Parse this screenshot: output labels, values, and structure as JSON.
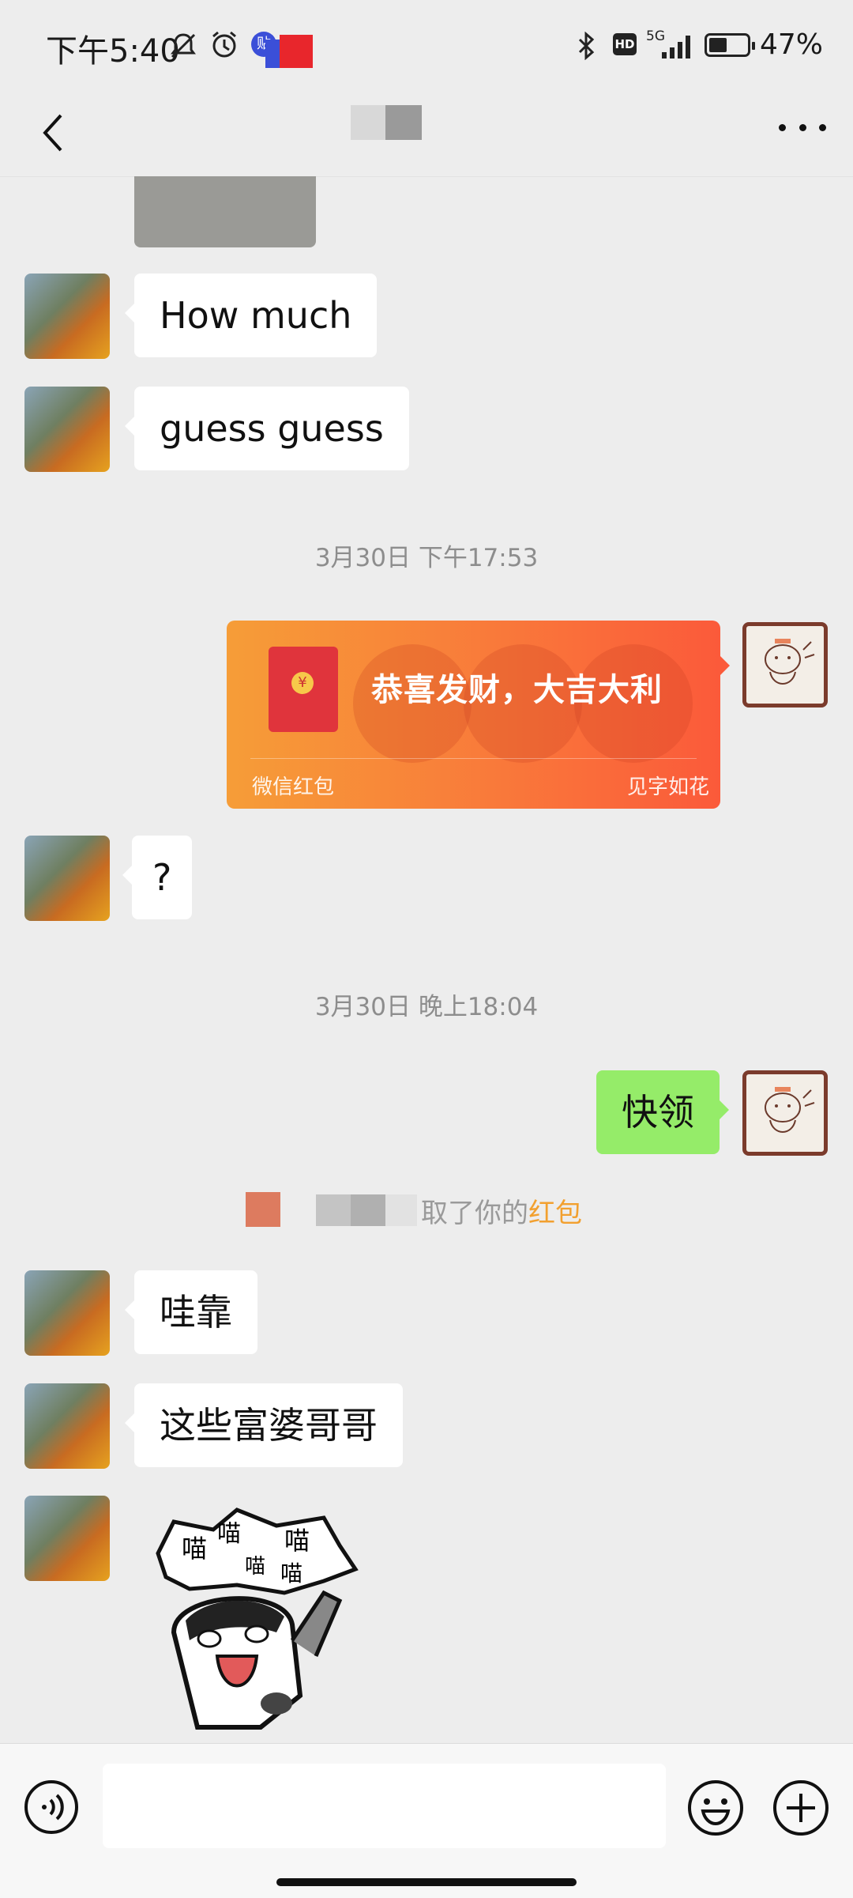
{
  "status_bar": {
    "time": "下午5:40",
    "network": "5G",
    "battery": "47%",
    "hd_badge": "HD",
    "sticker_badge": "贴"
  },
  "chat": {
    "back_icon": "chevron-left-icon",
    "more_icon": "ellipsis-icon"
  },
  "messages": [
    {
      "side": "left",
      "type": "text",
      "text": "How much"
    },
    {
      "side": "left",
      "type": "text",
      "text": "guess guess"
    },
    {
      "type": "timestamp",
      "text": "3月30日 下午17:53"
    },
    {
      "side": "right",
      "type": "red_packet",
      "greeting": "恭喜发财，大吉大利",
      "footer_left": "微信红包",
      "footer_right": "见字如花"
    },
    {
      "side": "left",
      "type": "text",
      "text": "?"
    },
    {
      "type": "timestamp",
      "text": "3月30日 晚上18:04"
    },
    {
      "side": "right",
      "type": "text",
      "text": "快领"
    },
    {
      "type": "system",
      "text": "取了你的",
      "link": "红包"
    },
    {
      "side": "left",
      "type": "text",
      "text": "哇靠"
    },
    {
      "side": "left",
      "type": "text",
      "text": "这些富婆哥哥"
    },
    {
      "side": "left",
      "type": "sticker",
      "caption": "喵喵喵喵喵"
    }
  ],
  "sticker_text": [
    "喵",
    "喵",
    "喵",
    "喵",
    "喵"
  ],
  "red_packet_coin": "¥",
  "input_bar": {
    "voice_icon": "voice-icon",
    "emoji_icon": "emoji-icon",
    "plus_icon": "plus-icon",
    "placeholder": ""
  },
  "colors": {
    "background": "#ededed",
    "bubble_self": "#95ec69",
    "red_packet": "#f9793a",
    "link_orange": "#f2a02f"
  }
}
